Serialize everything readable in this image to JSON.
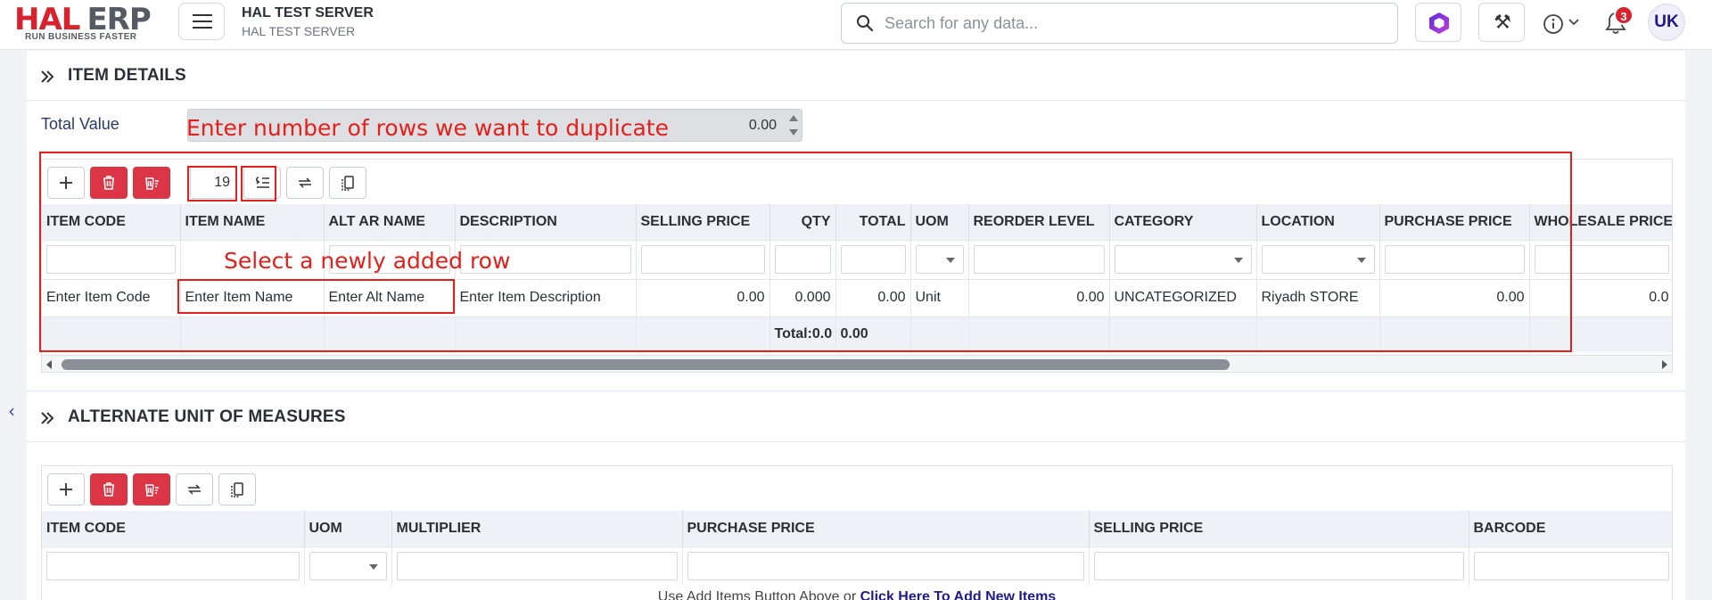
{
  "header": {
    "logo_main": "HAL",
    "logo_sub": "ERP",
    "logo_tagline": "RUN BUSINESS FASTER",
    "server_title": "HAL TEST SERVER",
    "server_subtitle": "HAL TEST SERVER",
    "search_placeholder": "Search for any data...",
    "notification_count": "3",
    "avatar_initials": "UK"
  },
  "item_details": {
    "title": "ITEM DETAILS",
    "total_value_label": "Total Value",
    "total_value": "0.00",
    "row_count": "19",
    "columns": [
      "ITEM CODE",
      "ITEM NAME",
      "ALT AR NAME",
      "DESCRIPTION",
      "SELLING PRICE",
      "QTY",
      "TOTAL",
      "UOM",
      "REORDER LEVEL",
      "CATEGORY",
      "LOCATION",
      "PURCHASE PRICE",
      "WHOLESALE PRICE"
    ],
    "row": {
      "item_code": "Enter Item Code",
      "item_name": "Enter Item Name",
      "alt_name": "Enter Alt Name",
      "description": "Enter Item Description",
      "selling_price": "0.00",
      "qty": "0.000",
      "total": "0.00",
      "uom": "Unit",
      "reorder_level": "0.00",
      "category": "UNCATEGORIZED",
      "location": "Riyadh STORE",
      "purchase_price": "0.00",
      "wholesale_price": "0.0"
    },
    "footer_total_label": "Total:0.0",
    "footer_total_value": "0.00"
  },
  "annotations": {
    "duplicate_hint": "Enter number of rows we want to duplicate",
    "select_hint": "Select a newly added row"
  },
  "alt_uom": {
    "title": "ALTERNATE UNIT OF MEASURES",
    "columns": [
      "ITEM CODE",
      "UOM",
      "MULTIPLIER",
      "PURCHASE PRICE",
      "SELLING PRICE",
      "BARCODE"
    ],
    "empty_text": "Use Add Items Button Above or ",
    "empty_link": "Click Here To Add New Items"
  },
  "colors": {
    "brand_red": "#d8232f",
    "annotation_red": "#e3201b",
    "link_navy": "#1f1a8a",
    "header_bg": "#eef1f6"
  },
  "icons": [
    "menu-icon",
    "search-icon",
    "hexagon-logo-icon",
    "tools-icon",
    "info-icon",
    "bell-icon",
    "double-chevron-icon",
    "plus-icon",
    "trash-icon",
    "delete-rows-icon",
    "duplicate-rows-icon",
    "swap-icon",
    "copy-icon"
  ]
}
